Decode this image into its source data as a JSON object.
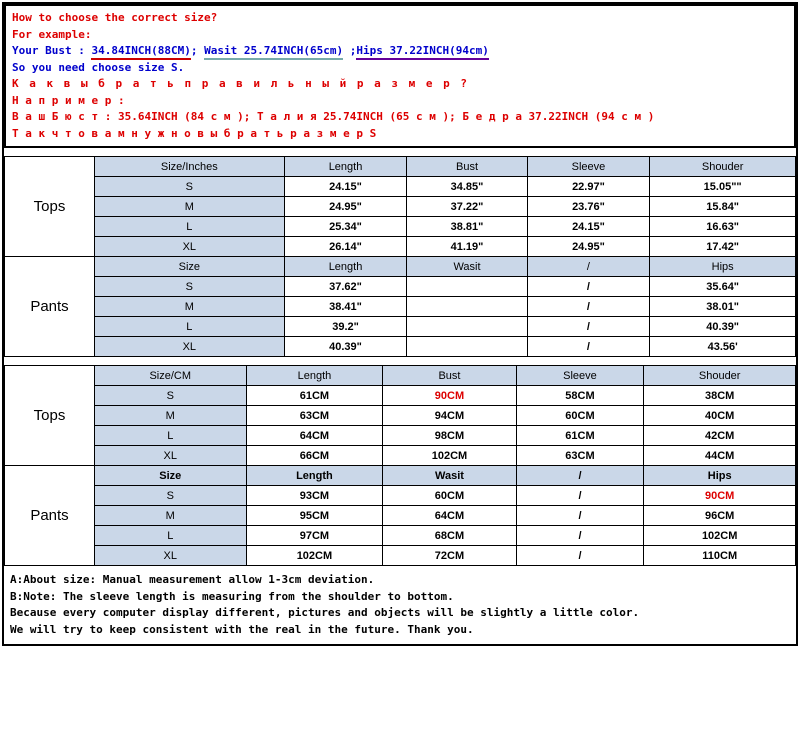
{
  "intro": {
    "q": "How to choose the correct size?",
    "ex": "For example:",
    "your_bust_label": "Your Bust :",
    "bust_val": "34.84INCH(88CM)",
    "sep1": ";",
    "waist_label": "Wasit",
    "waist_val": "25.74INCH(65cm)",
    "sep2": ";",
    "hips_label": "Hips",
    "hips_val": "37.22INCH(94cm)",
    "conclude": "So you need choose size S.",
    "ru_q": "К а к   в ы б р а т ь   п р а в и л ь н ы й   р а з м е р ?",
    "ru_ex": "Н а п р и м е р :",
    "ru_line": "В а ш  Б ю с т : 35.64INCH (84 с м );  Т а л и я  25.74INCH (65 с м );  Б е д р а  37.22INCH (94 с м )",
    "ru_conclude": "Т а к  ч т о  в а м  н у ж н о  в ы б р а т ь  р а з м е р S"
  },
  "tables": {
    "inches": {
      "tops": {
        "label": "Tops",
        "header": [
          "Size/Inches",
          "Length",
          "Bust",
          "Sleeve",
          "Shouder"
        ],
        "rows": [
          [
            "S",
            "24.15\"",
            "34.85\"",
            "22.97\"",
            "15.05\"\""
          ],
          [
            "M",
            "24.95\"",
            "37.22\"",
            "23.76\"",
            "15.84\""
          ],
          [
            "L",
            "25.34\"",
            "38.81\"",
            "24.15\"",
            "16.63\""
          ],
          [
            "XL",
            "26.14\"",
            "41.19\"",
            "24.95\"",
            "17.42\""
          ]
        ]
      },
      "pants": {
        "label": "Pants",
        "header": [
          "Size",
          "Length",
          "Wasit",
          "/",
          "Hips"
        ],
        "rows": [
          [
            "S",
            "37.62\"",
            "",
            "/",
            "35.64\""
          ],
          [
            "M",
            "38.41\"",
            "",
            "/",
            "38.01\""
          ],
          [
            "L",
            "39.2\"",
            "",
            "/",
            "40.39\""
          ],
          [
            "XL",
            "40.39\"",
            "",
            "/",
            "43.56'"
          ]
        ]
      }
    },
    "cm": {
      "tops": {
        "label": "Tops",
        "header": [
          "Size/CM",
          "Length",
          "Bust",
          "Sleeve",
          "Shouder"
        ],
        "rows": [
          [
            "S",
            "61CM",
            "90CM",
            "58CM",
            "38CM"
          ],
          [
            "M",
            "63CM",
            "94CM",
            "60CM",
            "40CM"
          ],
          [
            "L",
            "64CM",
            "98CM",
            "61CM",
            "42CM"
          ],
          [
            "XL",
            "66CM",
            "102CM",
            "63CM",
            "44CM"
          ]
        ],
        "highlight": {
          "r": 0,
          "c": 2
        }
      },
      "pants": {
        "label": "Pants",
        "header": [
          "Size",
          "Length",
          "Wasit",
          "/",
          "Hips"
        ],
        "rows": [
          [
            "S",
            "93CM",
            "60CM",
            "/",
            "90CM"
          ],
          [
            "M",
            "95CM",
            "64CM",
            "/",
            "96CM"
          ],
          [
            "L",
            "97CM",
            "68CM",
            "/",
            "102CM"
          ],
          [
            "XL",
            "102CM",
            "72CM",
            "/",
            "110CM"
          ]
        ],
        "highlight": {
          "r": 0,
          "c": 4
        }
      }
    }
  },
  "footer": {
    "a": "A:About size: Manual measurement allow 1-3cm deviation.",
    "b": "B:Note: The sleeve length is measuring from the shoulder to bottom.",
    "c": "Because every computer display different, pictures and objects will be slightly a little color.",
    "d": "We will try to keep consistent with the real in the future. Thank you."
  }
}
